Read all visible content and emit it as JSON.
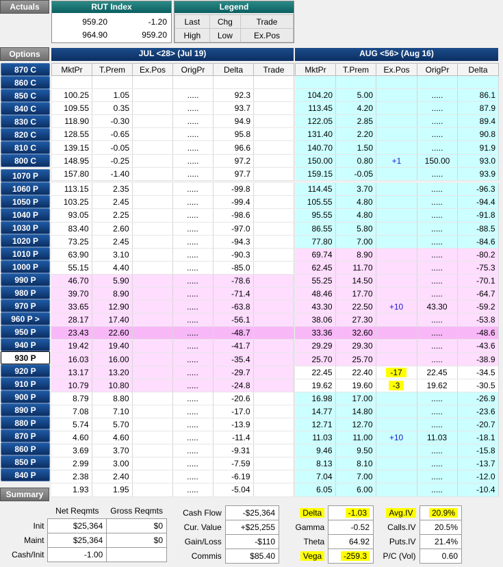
{
  "actuals_label": "Actuals",
  "rut": {
    "title": "RUT Index",
    "rows": [
      [
        "959.20",
        "-1.20"
      ],
      [
        "964.90",
        "959.20"
      ]
    ]
  },
  "legend": {
    "title": "Legend",
    "rows": [
      [
        "Last",
        "Chg",
        "Trade"
      ],
      [
        "High",
        "Low",
        "Ex.Pos"
      ]
    ]
  },
  "options_label": "Options",
  "jul_header": "JUL <28> (Jul 19)",
  "aug_header": "AUG <56> (Aug 16)",
  "jul_cols": [
    "MktPr",
    "T.Prem",
    "Ex.Pos",
    "OrigPr",
    "Delta",
    "Trade"
  ],
  "aug_cols": [
    "MktPr",
    "T.Prem",
    "Ex.Pos",
    "OrigPr",
    "Delta"
  ],
  "calls": [
    {
      "strike": "870 C",
      "jul": [
        "",
        "",
        "",
        "",
        "",
        ""
      ],
      "aug": [
        "",
        "",
        "",
        "",
        ""
      ]
    },
    {
      "strike": "860 C",
      "jul": [
        "100.25",
        "1.05",
        "",
        ".....",
        "92.3",
        ""
      ],
      "aug": [
        "104.20",
        "5.00",
        "",
        ".....",
        "86.1"
      ]
    },
    {
      "strike": "850 C",
      "jul": [
        "109.55",
        "0.35",
        "",
        ".....",
        "93.7",
        ""
      ],
      "aug": [
        "113.45",
        "4.20",
        "",
        ".....",
        "87.9"
      ]
    },
    {
      "strike": "840 C",
      "jul": [
        "118.90",
        "-0.30",
        "",
        ".....",
        "94.9",
        ""
      ],
      "aug": [
        "122.05",
        "2.85",
        "",
        ".....",
        "89.4"
      ]
    },
    {
      "strike": "830 C",
      "jul": [
        "128.55",
        "-0.65",
        "",
        ".....",
        "95.8",
        ""
      ],
      "aug": [
        "131.40",
        "2.20",
        "",
        ".....",
        "90.8"
      ]
    },
    {
      "strike": "820 C",
      "jul": [
        "139.15",
        "-0.05",
        "",
        ".....",
        "96.6",
        ""
      ],
      "aug": [
        "140.70",
        "1.50",
        "",
        ".....",
        "91.9"
      ]
    },
    {
      "strike": "810 C",
      "jul": [
        "148.95",
        "-0.25",
        "",
        ".....",
        "97.2",
        ""
      ],
      "aug": [
        "150.00",
        "0.80",
        "+1",
        "150.00",
        "93.0"
      ]
    },
    {
      "strike": "800 C",
      "jul": [
        "157.80",
        "-1.40",
        "",
        ".....",
        "97.7",
        ""
      ],
      "aug": [
        "159.15",
        "-0.05",
        "",
        ".....",
        "93.9"
      ]
    }
  ],
  "puts": [
    {
      "strike": "1070 P",
      "jul": [
        "113.15",
        "2.35",
        "",
        ".....",
        "-99.8",
        ""
      ],
      "aug": [
        "114.45",
        "3.70",
        "",
        ".....",
        "-96.3"
      ]
    },
    {
      "strike": "1060 P",
      "jul": [
        "103.25",
        "2.45",
        "",
        ".....",
        "-99.4",
        ""
      ],
      "aug": [
        "105.55",
        "4.80",
        "",
        ".....",
        "-94.4"
      ]
    },
    {
      "strike": "1050 P",
      "jul": [
        "93.05",
        "2.25",
        "",
        ".....",
        "-98.6",
        ""
      ],
      "aug": [
        "95.55",
        "4.80",
        "",
        ".....",
        "-91.8"
      ]
    },
    {
      "strike": "1040 P",
      "jul": [
        "83.40",
        "2.60",
        "",
        ".....",
        "-97.0",
        ""
      ],
      "aug": [
        "86.55",
        "5.80",
        "",
        ".....",
        "-88.5"
      ]
    },
    {
      "strike": "1030 P",
      "jul": [
        "73.25",
        "2.45",
        "",
        ".....",
        "-94.3",
        ""
      ],
      "aug": [
        "77.80",
        "7.00",
        "",
        ".....",
        "-84.6"
      ]
    },
    {
      "strike": "1020 P",
      "jul": [
        "63.90",
        "3.10",
        "",
        ".....",
        "-90.3",
        ""
      ],
      "aug": [
        "69.74",
        "8.90",
        "",
        ".....",
        "-80.2"
      ]
    },
    {
      "strike": "1010 P",
      "jul": [
        "55.15",
        "4.40",
        "",
        ".....",
        "-85.0",
        ""
      ],
      "aug": [
        "62.45",
        "11.70",
        "",
        ".....",
        "-75.3"
      ]
    },
    {
      "strike": "1000 P",
      "jul": [
        "46.70",
        "5.90",
        "",
        ".....",
        "-78.6",
        ""
      ],
      "aug": [
        "55.25",
        "14.50",
        "",
        ".....",
        "-70.1"
      ]
    },
    {
      "strike": "990 P",
      "jul": [
        "39.70",
        "8.90",
        "",
        ".....",
        "-71.4",
        ""
      ],
      "aug": [
        "48.46",
        "17.70",
        "",
        ".....",
        "-64.7"
      ]
    },
    {
      "strike": "980 P",
      "jul": [
        "33.65",
        "12.90",
        "",
        ".....",
        "-63.8",
        ""
      ],
      "aug": [
        "43.30",
        "22.50",
        "+10",
        "43.30",
        "-59.2"
      ]
    },
    {
      "strike": "970 P",
      "jul": [
        "28.17",
        "17.40",
        "",
        ".....",
        "-56.1",
        ""
      ],
      "aug": [
        "38.06",
        "27.30",
        "",
        ".....",
        "-53.8"
      ]
    },
    {
      "strike": "960 P >",
      "jul": [
        "23.43",
        "22.60",
        "",
        ".....",
        "-48.7",
        ""
      ],
      "aug": [
        "33.36",
        "32.60",
        "",
        ".....",
        "-48.6"
      ]
    },
    {
      "strike": "950 P",
      "jul": [
        "19.42",
        "19.40",
        "",
        ".....",
        "-41.7",
        ""
      ],
      "aug": [
        "29.29",
        "29.30",
        "",
        ".....",
        "-43.6"
      ]
    },
    {
      "strike": "940 P",
      "jul": [
        "16.03",
        "16.00",
        "",
        ".....",
        "-35.4",
        ""
      ],
      "aug": [
        "25.70",
        "25.70",
        "",
        ".....",
        "-38.9"
      ]
    },
    {
      "strike": "930 P",
      "jul": [
        "13.17",
        "13.20",
        "",
        ".....",
        "-29.7",
        ""
      ],
      "aug": [
        "22.45",
        "22.40",
        "-17",
        "22.45",
        "-34.5"
      ]
    },
    {
      "strike": "920 P",
      "jul": [
        "10.79",
        "10.80",
        "",
        ".....",
        "-24.8",
        ""
      ],
      "aug": [
        "19.62",
        "19.60",
        "-3",
        "19.62",
        "-30.5"
      ]
    },
    {
      "strike": "910 P",
      "jul": [
        "8.79",
        "8.80",
        "",
        ".....",
        "-20.6",
        ""
      ],
      "aug": [
        "16.98",
        "17.00",
        "",
        ".....",
        "-26.9"
      ]
    },
    {
      "strike": "900 P",
      "jul": [
        "7.08",
        "7.10",
        "",
        ".....",
        "-17.0",
        ""
      ],
      "aug": [
        "14.77",
        "14.80",
        "",
        ".....",
        "-23.6"
      ]
    },
    {
      "strike": "890 P",
      "jul": [
        "5.74",
        "5.70",
        "",
        ".....",
        "-13.9",
        ""
      ],
      "aug": [
        "12.71",
        "12.70",
        "",
        ".....",
        "-20.7"
      ]
    },
    {
      "strike": "880 P",
      "jul": [
        "4.60",
        "4.60",
        "",
        ".....",
        "-11.4",
        ""
      ],
      "aug": [
        "11.03",
        "11.00",
        "+10",
        "11.03",
        "-18.1"
      ]
    },
    {
      "strike": "870 P",
      "jul": [
        "3.69",
        "3.70",
        "",
        ".....",
        "-9.31",
        ""
      ],
      "aug": [
        "9.46",
        "9.50",
        "",
        ".....",
        "-15.8"
      ]
    },
    {
      "strike": "860 P",
      "jul": [
        "2.99",
        "3.00",
        "",
        ".....",
        "-7.59",
        ""
      ],
      "aug": [
        "8.13",
        "8.10",
        "",
        ".....",
        "-13.7"
      ]
    },
    {
      "strike": "850 P",
      "jul": [
        "2.38",
        "2.40",
        "",
        ".....",
        "-6.19",
        ""
      ],
      "aug": [
        "7.04",
        "7.00",
        "",
        ".....",
        "-12.0"
      ]
    },
    {
      "strike": "840 P",
      "jul": [
        "1.93",
        "1.95",
        "",
        ".....",
        "-5.04",
        ""
      ],
      "aug": [
        "6.05",
        "6.00",
        "",
        ".....",
        "-10.4"
      ]
    }
  ],
  "summary": {
    "label": "Summary",
    "reqmts_headers": [
      "Net Reqmts",
      "Gross Reqmts"
    ],
    "reqmts": [
      {
        "label": "Init",
        "net": "$25,364",
        "gross": "$0"
      },
      {
        "label": "Maint",
        "net": "$25,364",
        "gross": "$0"
      },
      {
        "label": "Cash/Init",
        "net": "-1.00",
        "gross": ""
      }
    ],
    "cash": [
      {
        "label": "Cash Flow",
        "value": "-$25,364"
      },
      {
        "label": "Cur. Value",
        "value": "+$25,255"
      },
      {
        "label": "Gain/Loss",
        "value": "-$110"
      },
      {
        "label": "Commis",
        "value": "$85.40"
      }
    ],
    "greeks": [
      {
        "label": "Delta",
        "value": "-1.03"
      },
      {
        "label": "Gamma",
        "value": "-0.52"
      },
      {
        "label": "Theta",
        "value": "64.92"
      },
      {
        "label": "Vega",
        "value": "-259.3"
      }
    ],
    "vol": [
      {
        "label": "Avg.IV",
        "value": "20.9%"
      },
      {
        "label": "Calls.IV",
        "value": "20.5%"
      },
      {
        "label": "Puts.IV",
        "value": "21.4%"
      },
      {
        "label": "P/C (Vol)",
        "value": "0.60"
      }
    ]
  }
}
